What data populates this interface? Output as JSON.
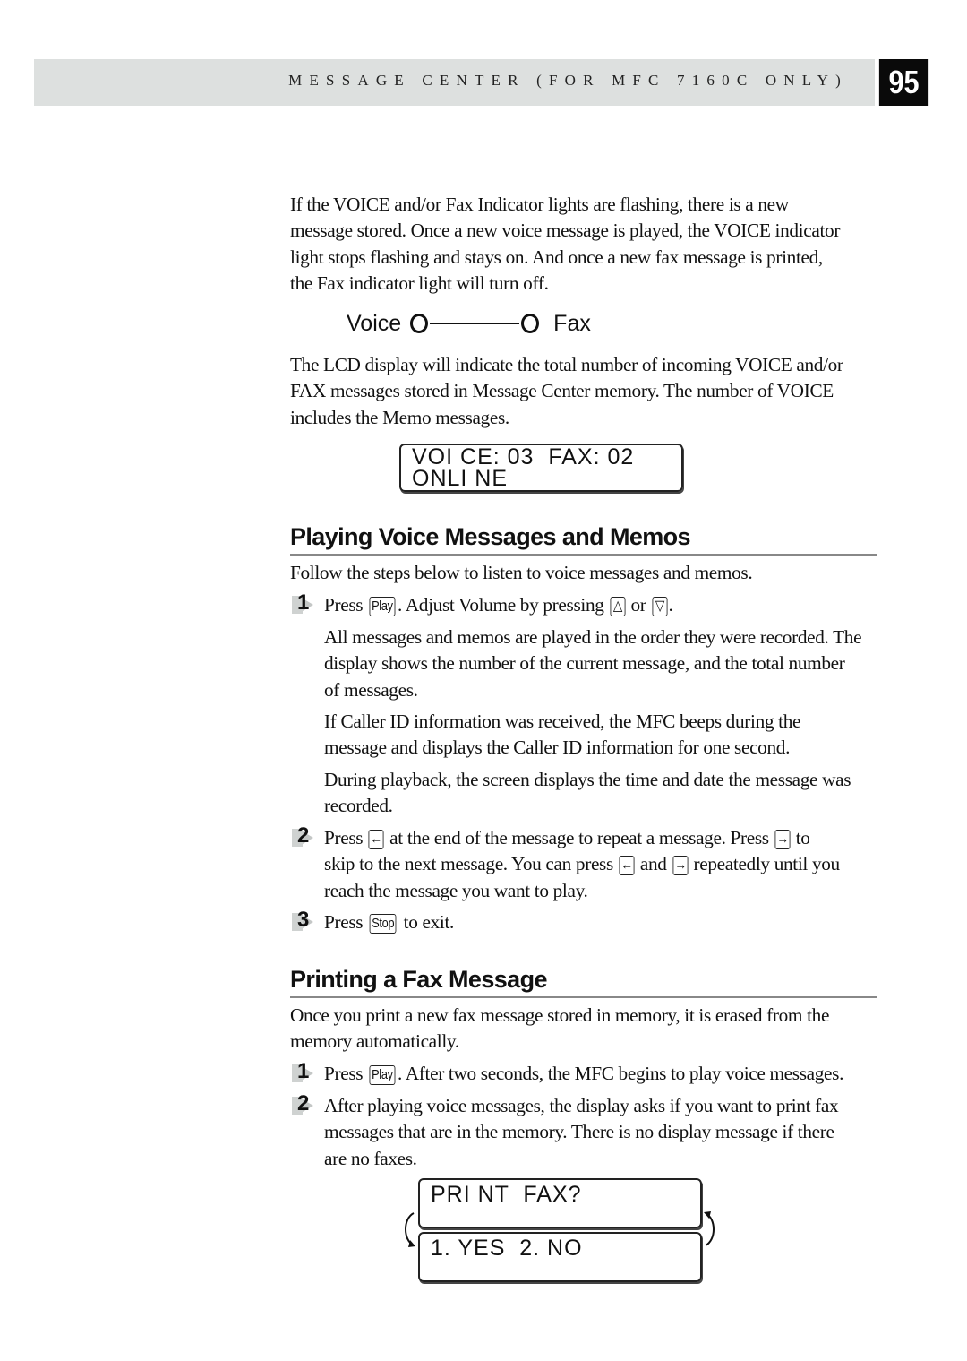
{
  "header": {
    "title": "MESSAGE CENTER (FOR MFC 7160C ONLY)",
    "page_number": "95"
  },
  "intro": {
    "paragraph_lines": [
      "If the VOICE and/or Fax Indicator lights are flashing, there is a new",
      "message stored. Once a new voice message is played, the VOICE indicator",
      "light stops flashing and stays on. And once a new fax message is printed,",
      "the Fax indicator light will turn off."
    ]
  },
  "indicator": {
    "voice_label": "Voice",
    "fax_label": "Fax"
  },
  "lcd_intro": {
    "paragraph_lines": [
      "The LCD display will indicate the total number of incoming VOICE and/or",
      "FAX messages stored in Message Center memory. The number of VOICE",
      "includes the Memo messages."
    ]
  },
  "lcd_status": {
    "line1": "VOI CE: 03  FAX: 02",
    "line2": "ONLI NE"
  },
  "section_playing": {
    "heading": "Playing Voice Messages and Memos",
    "intro": "Follow the steps below to listen to voice messages and memos.",
    "steps": [
      {
        "number": "1",
        "parts": [
          "Press ",
          ". Adjust Volume by pressing ",
          " or ",
          "."
        ],
        "keys": [
          "Play",
          "up-arrow-key",
          "down-arrow-key"
        ],
        "notes": [
          [
            "All messages and memos are played in the order they were recorded. The",
            "display shows the number of the current message, and the total number",
            "of messages."
          ],
          [
            "If Caller ID information was received, the MFC beeps during the",
            "message and displays the Caller ID information for one second."
          ],
          [
            "During playback, the screen displays the time and date the message was",
            "recorded."
          ]
        ]
      },
      {
        "number": "2",
        "line1_parts": [
          "Press ",
          " at the end of the message to repeat a message. Press ",
          " to"
        ],
        "line2_parts": [
          "skip to the next message. You can press ",
          " and ",
          " repeatedly until you"
        ],
        "line3": "reach the message you want to play.",
        "keys": [
          "left-arrow-key",
          "right-arrow-key"
        ]
      },
      {
        "number": "3",
        "parts": [
          "Press ",
          " to exit."
        ],
        "keys": [
          "Stop"
        ]
      }
    ]
  },
  "section_printing": {
    "heading": "Printing a Fax Message",
    "intro_lines": [
      "Once you print a new fax message stored in memory, it is erased from the",
      "memory automatically."
    ],
    "steps": [
      {
        "number": "1",
        "parts": [
          "Press ",
          ". After two seconds, the MFC begins to play voice messages."
        ],
        "keys": [
          "Play"
        ]
      },
      {
        "number": "2",
        "lines": [
          "After playing voice messages, the display asks if you want to print fax",
          "messages that are in the memory. There is no display message if there",
          "are no faxes."
        ]
      }
    ]
  },
  "lcd_print": {
    "screen1": "PRI NT  FAX?",
    "screen2": "1. YES  2. NO"
  },
  "key_glyphs": {
    "up": "△",
    "down": "▽",
    "left": "←",
    "right": "→"
  }
}
